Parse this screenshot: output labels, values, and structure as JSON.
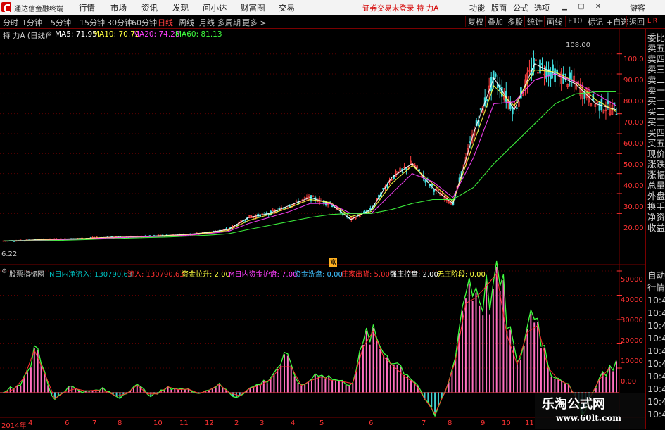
{
  "app": {
    "title": "通达信金融终端",
    "menu": [
      "行情",
      "市场",
      "资讯",
      "发现",
      "问小达",
      "财富圈",
      "交易"
    ],
    "notice": "证券交易未登录  特 力A",
    "right_menu": [
      "功能",
      "版面",
      "公式",
      "选项"
    ],
    "guest": "游客",
    "window_buttons": [
      "minimize-icon",
      "maximize-icon",
      "close-icon"
    ]
  },
  "period_bar": {
    "items": [
      "分时",
      "1分钟",
      "5分钟",
      "15分钟",
      "30分钟",
      "60分钟",
      "日线",
      "周线",
      "月线",
      "多周期",
      "更多 >"
    ],
    "active": "日线",
    "tools": [
      "复权",
      "叠加",
      "多股",
      "统计",
      "画线",
      "F10",
      "标记",
      "+自选",
      "返回"
    ]
  },
  "main_chart": {
    "title": "特 力A (日线)",
    "ma": [
      {
        "label": "MA5: 71.95",
        "color": "#ffffff"
      },
      {
        "label": "MA10: 70.72",
        "color": "#ffff40"
      },
      {
        "label": "MA20: 74.28",
        "color": "#ff40ff"
      },
      {
        "label": "MA60: 81.13",
        "color": "#40ff40"
      }
    ],
    "y_ticks": [
      "100.0",
      "90.00",
      "80.00",
      "70.00",
      "60.00",
      "50.00",
      "40.00",
      "30.00",
      "20.00"
    ],
    "high_label": "108.00",
    "low_label": "6.22",
    "marker": "富"
  },
  "indicator": {
    "name": "股票指标网",
    "items": [
      {
        "label": "N日内净流入: 130790.63",
        "color": "#00c0c0"
      },
      {
        "label": "流入: 130790.63",
        "color": "#ff3030"
      },
      {
        "label": "资金拉升: 2.00",
        "color": "#ffff40"
      },
      {
        "label": "M日内资金护盘: 7.00",
        "color": "#ff40ff"
      },
      {
        "label": "资金洗盘: 0.00",
        "color": "#40c0ff"
      },
      {
        "label": "庄家出货: 5.00",
        "color": "#ff3030"
      },
      {
        "label": "强庄控盘: 2.00",
        "color": "#ffffff"
      },
      {
        "label": "无庄阶段: 0.00",
        "color": "#ffff40"
      }
    ],
    "y_ticks": [
      "50000",
      "40000",
      "30000",
      "20000",
      "10000",
      "0.00"
    ]
  },
  "date_axis": [
    "2014年",
    "4",
    "6",
    "7",
    "8",
    "10",
    "11",
    "12",
    "2",
    "3",
    "4",
    "5",
    "6",
    "7",
    "8",
    "9",
    "10",
    "11"
  ],
  "right_panel": {
    "top": [
      "委比",
      "卖五",
      "卖四",
      "卖三",
      "卖二",
      "卖一",
      "买一",
      "买二",
      "买三",
      "买四",
      "买五",
      "现价",
      "涨跌",
      "涨幅",
      "总量",
      "外盘",
      "换手",
      "净资",
      "收益"
    ],
    "bottom": [
      "自动",
      "行情",
      "10:4",
      "10:4",
      "10:4",
      "10:4",
      "10:4",
      "10:4",
      "10:4",
      "10:4",
      "10:4",
      "10:4"
    ],
    "badge": "L  R"
  },
  "watermark": {
    "line1": "乐淘公式网",
    "line2": "www.60lt.com"
  },
  "chart_data": [
    {
      "type": "line",
      "title": "特 力A (日线)",
      "series": [
        {
          "name": "MA5",
          "values": [
            6.3,
            6.5,
            7.0,
            7.2,
            7.5,
            8.0,
            8.2,
            8.5,
            9.0,
            9.5,
            10.5,
            12,
            18,
            20,
            24,
            28,
            25,
            17,
            22,
            38,
            45,
            33,
            25,
            60,
            88,
            72,
            95,
            90,
            85,
            75,
            72
          ]
        },
        {
          "name": "MA10",
          "values": [
            6.3,
            6.4,
            6.8,
            7.1,
            7.4,
            7.9,
            8.1,
            8.4,
            8.8,
            9.3,
            10.2,
            11.5,
            16.5,
            19.5,
            23,
            27,
            25.5,
            18.5,
            21,
            35,
            44,
            35,
            26,
            55,
            84,
            74,
            92,
            91,
            86,
            77,
            71
          ]
        },
        {
          "name": "MA20",
          "values": [
            6.3,
            6.4,
            6.6,
            6.9,
            7.2,
            7.7,
            8.0,
            8.3,
            8.6,
            9.1,
            9.9,
            11,
            15,
            18,
            21,
            25,
            25,
            20,
            20,
            30,
            40,
            36,
            28,
            48,
            75,
            76,
            87,
            90,
            86,
            80,
            74
          ]
        },
        {
          "name": "MA60",
          "values": [
            6.3,
            6.3,
            6.4,
            6.6,
            6.9,
            7.3,
            7.6,
            7.9,
            8.2,
            8.6,
            9.1,
            9.8,
            12,
            14,
            16,
            18,
            19.5,
            20,
            20,
            22,
            25,
            27,
            27,
            33,
            45,
            55,
            65,
            75,
            80,
            81,
            81
          ]
        }
      ],
      "ylim": [
        0,
        110
      ]
    },
    {
      "type": "bar",
      "title": "股票指标网",
      "series": [
        {
          "name": "N日内净流入",
          "values": [
            500,
            3000,
            17000,
            -3000,
            2500,
            0,
            1200,
            -2000,
            3000,
            -1500,
            2000,
            1000,
            0,
            3000,
            -2000,
            2000,
            5000,
            14000,
            2000,
            8000,
            5000,
            3000,
            24000,
            16000,
            10000,
            3000,
            -10000,
            6000,
            45000,
            38000,
            43000,
            10000,
            35000,
            8000,
            4000,
            -8000,
            6000,
            12000
          ]
        },
        {
          "name": "流入",
          "values": [
            500,
            3000,
            17000,
            -3000,
            2500,
            0,
            1200,
            -2000,
            3000,
            -1500,
            2000,
            1000,
            0,
            3000,
            -2000,
            2000,
            5000,
            14000,
            2000,
            8000,
            5000,
            3000,
            24000,
            16000,
            10000,
            3000,
            -10000,
            6000,
            45000,
            38000,
            43000,
            10000,
            35000,
            8000,
            4000,
            -8000,
            6000,
            12000
          ]
        }
      ],
      "ylim": [
        -10000,
        50000
      ]
    }
  ]
}
